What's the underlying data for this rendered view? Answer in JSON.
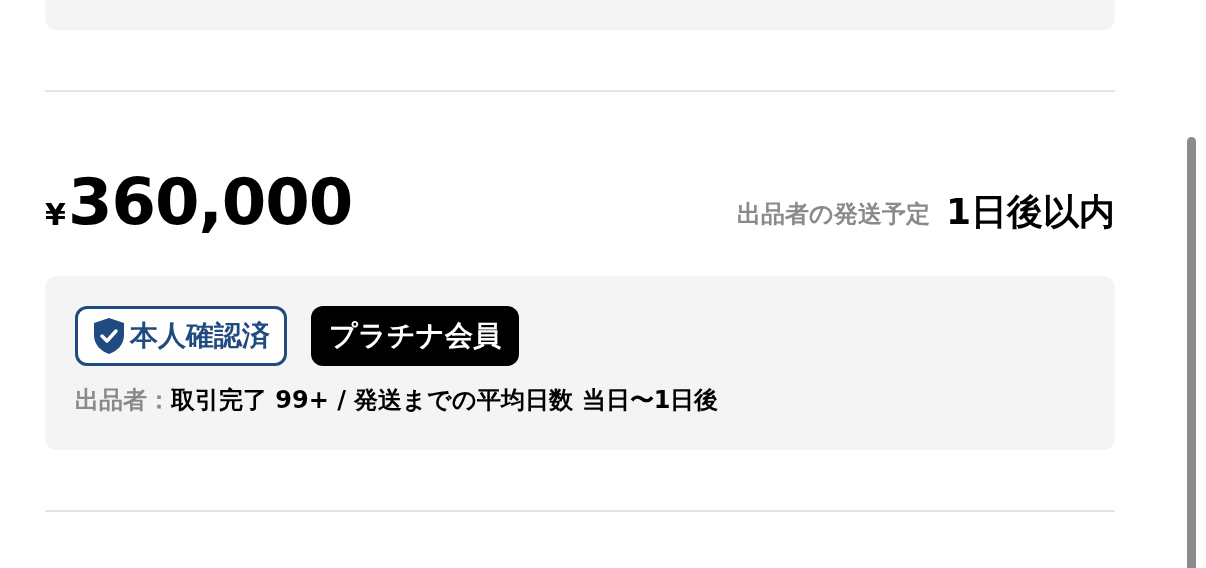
{
  "price": {
    "currency": "¥",
    "amount": "360,000"
  },
  "shipping": {
    "label": "出品者の発送予定",
    "value": "1日後以内"
  },
  "seller": {
    "badges": [
      {
        "kind": "verified",
        "label": "本人確認済"
      },
      {
        "kind": "member",
        "label": "プラチナ会員"
      }
    ],
    "label": "出品者：",
    "summary": "取引完了 99+ / 発送までの平均日数 当日〜1日後"
  }
}
